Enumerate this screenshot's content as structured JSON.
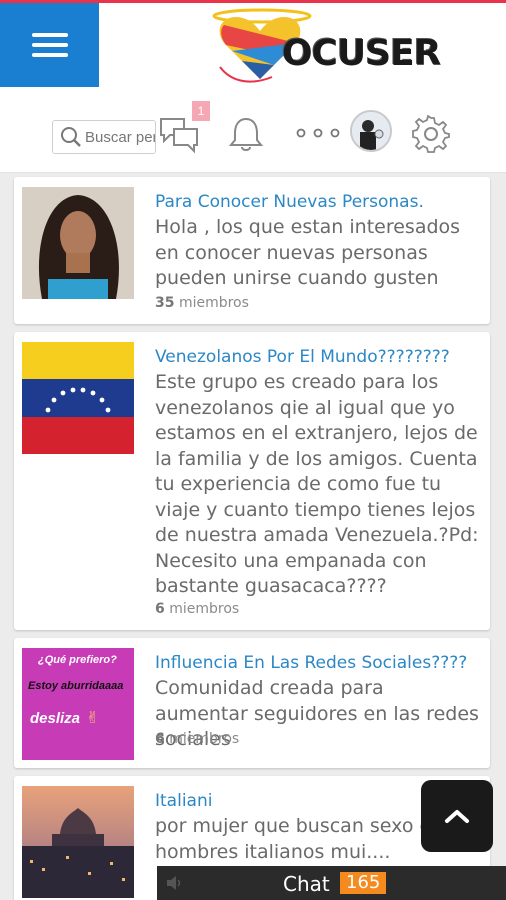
{
  "header": {
    "logo_text": "OCUSER",
    "menu_icon": "hamburger-icon"
  },
  "toolbar": {
    "search_placeholder": "Buscar personas",
    "messages_badge": "1",
    "icons": [
      "search-icon",
      "chat-icon",
      "bell-icon",
      "more-dots-icon",
      "avatar",
      "gear-icon"
    ]
  },
  "groups": [
    {
      "title": "Para Conocer Nuevas Personas.",
      "description": "Hola , los que estan interesados en conocer nuevas personas pueden unirse cuando gusten",
      "count": "35",
      "members_label": "miembros"
    },
    {
      "title": "Venezolanos Por El Mundo????????",
      "description": "Este grupo es creado para los venezolanos qie al igual que yo estamos en el extranjero, lejos de la familia y de los amigos. Cuenta tu experiencia de como fue tu viaje y cuanto tiempo tienes lejos de nuestra amada Venezuela.?Pd: Necesito una empanada con bastante guasacaca????",
      "count": "6",
      "members_label": "miembros"
    },
    {
      "title": "Influencia En Las Redes Sociales????",
      "description": "Comunidad creada para aumentar seguidores en las redes sociales",
      "count": "6",
      "members_label": "miembros",
      "thumb_text": {
        "line1": "¿Qué prefiero?",
        "line2": "Estoy aburridaaaa",
        "line3": "desliza"
      }
    },
    {
      "title": "Italiani",
      "description": "por mujer que buscan sexo con hombres italianos mui....",
      "count": "",
      "members_label": ""
    }
  ],
  "chat": {
    "label": "Chat",
    "count": "165"
  },
  "colors": {
    "accent": "#1a7fd0",
    "link": "#2b87c6",
    "badge": "#f58a1f",
    "top_line": "#e8334a"
  }
}
